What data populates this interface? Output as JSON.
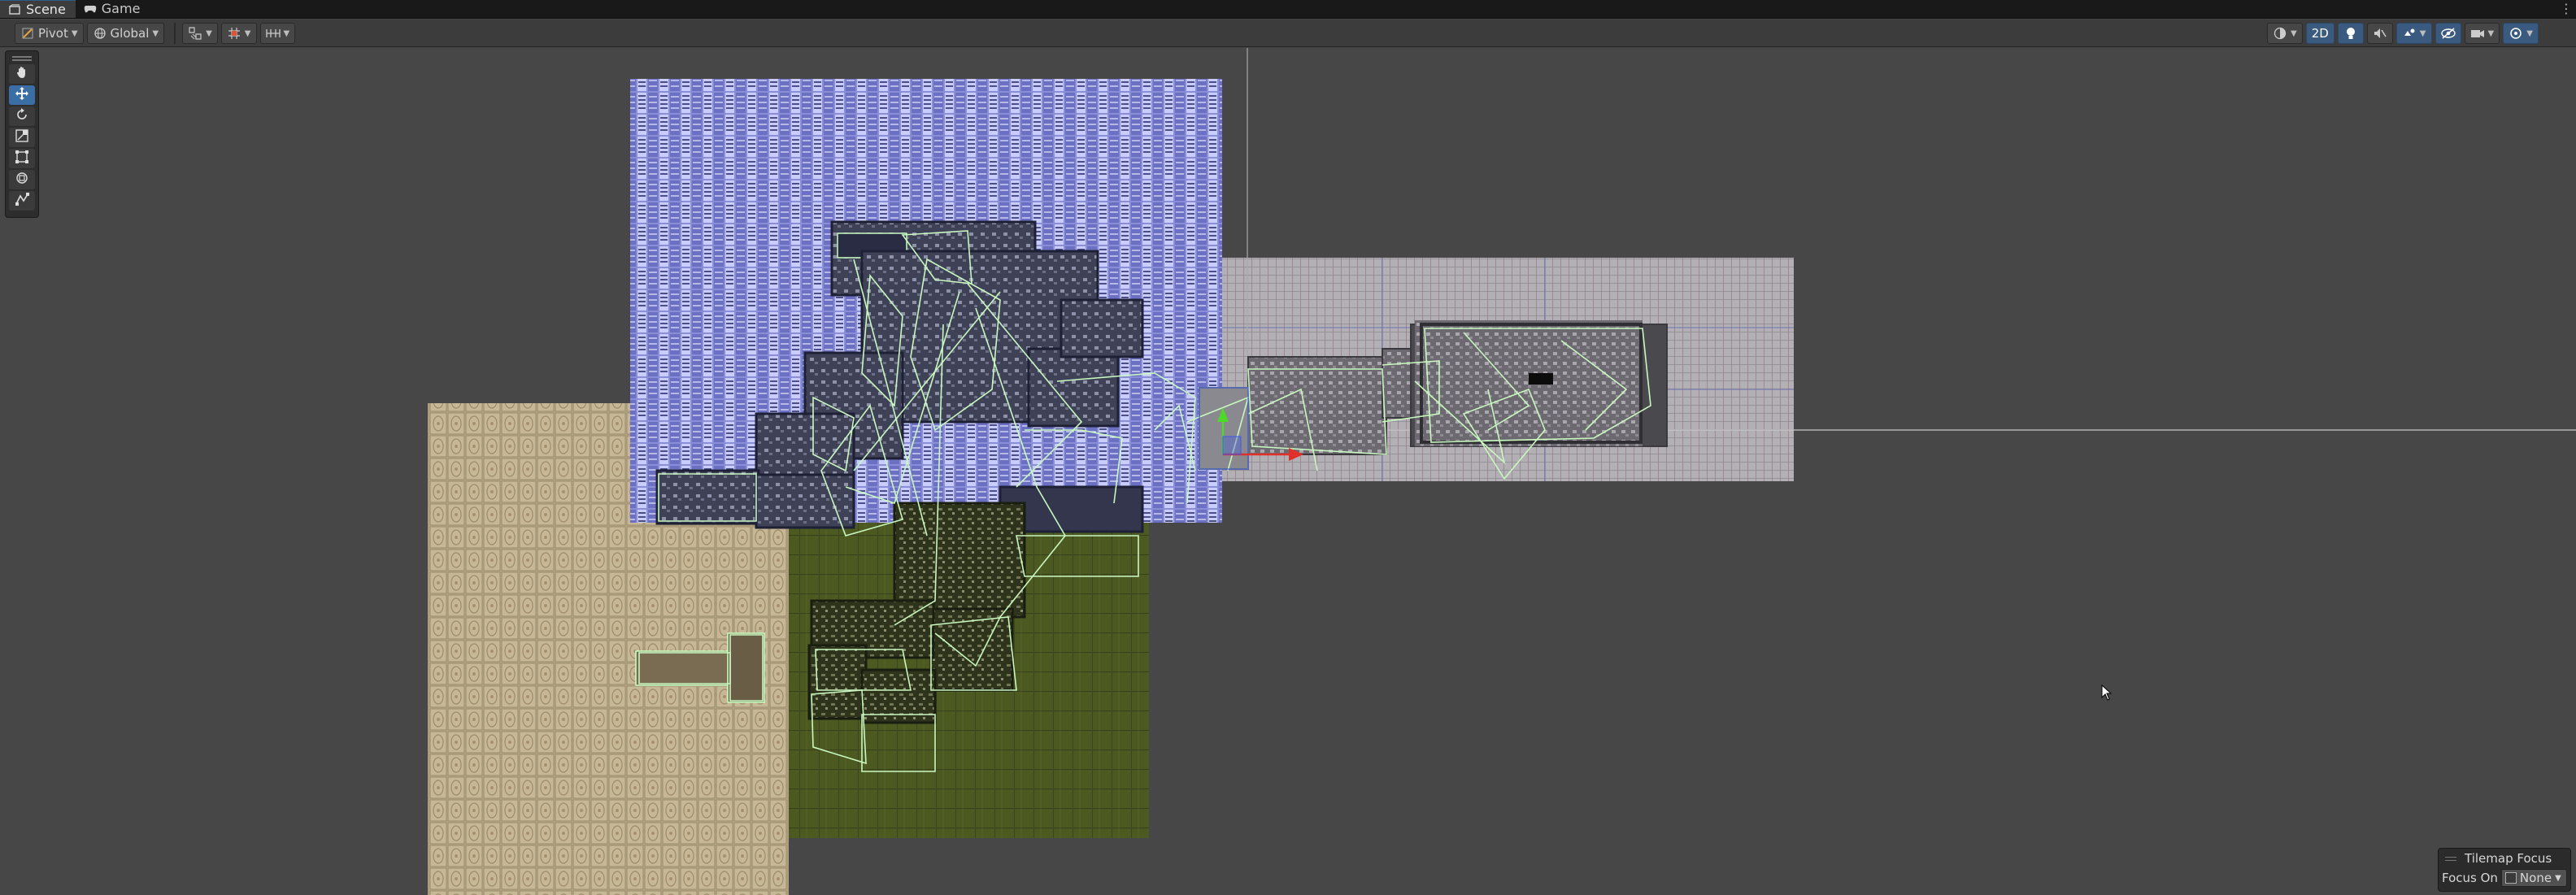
{
  "tabs": [
    {
      "label": "Scene",
      "icon": "scene-icon",
      "active": true
    },
    {
      "label": "Game",
      "icon": "game-icon",
      "active": false
    }
  ],
  "toolbar": {
    "pivot_label": "Pivot",
    "global_label": "Global",
    "mode_2d_label": "2D"
  },
  "tools": [
    "hand-tool",
    "move-tool",
    "rotate-tool",
    "scale-tool",
    "rect-tool",
    "transform-tool",
    "custom-tool"
  ],
  "tilemap_focus": {
    "title": "Tilemap Focus",
    "focus_on_label": "Focus On",
    "focus_on_value": "None"
  },
  "colors": {
    "scene_bg": "#474747",
    "accent": "#3a6ea5",
    "collider_green": "#b8f0b0",
    "axis_x_red": "#e0302a",
    "axis_y_green": "#4ed82c"
  }
}
